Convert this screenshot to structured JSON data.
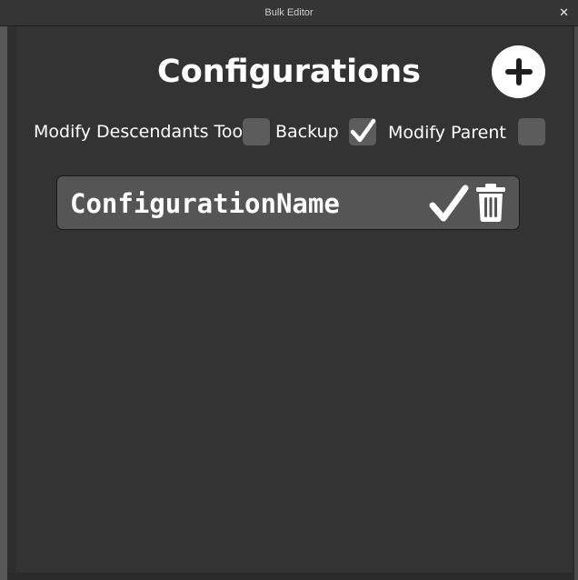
{
  "window": {
    "title": "Bulk Editor",
    "close_glyph": "✕"
  },
  "header": {
    "title": "Configurations",
    "add_icon": "plus-circle-icon"
  },
  "options": [
    {
      "label": "Modify Descendants Too",
      "checked": false
    },
    {
      "label": "Backup",
      "checked": true
    },
    {
      "label": "Modify Parent",
      "checked": false
    }
  ],
  "configurations": [
    {
      "name": "ConfigurationName",
      "apply_icon": "checkmark-icon",
      "delete_icon": "trash-icon"
    }
  ],
  "colors": {
    "background": "#333333",
    "checkbox": "#5c5c5c",
    "item": "#555555",
    "text": "#ffffff"
  }
}
